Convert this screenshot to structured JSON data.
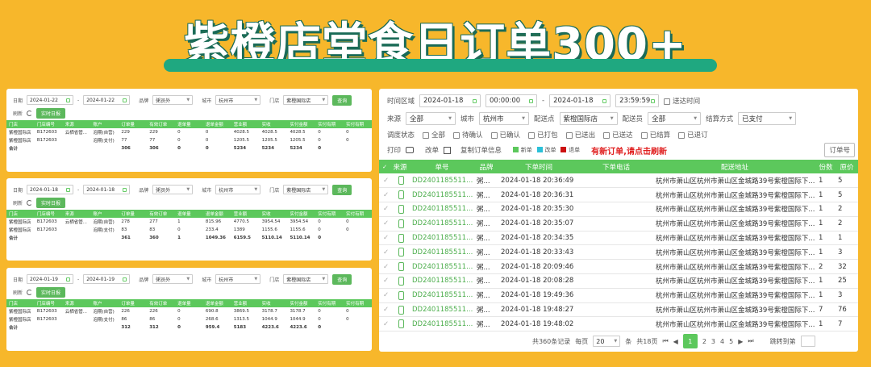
{
  "banner": {
    "title": "紫橙店堂食日订单300+"
  },
  "colors": {
    "accent": "#5cc85c",
    "background": "#f7b72b",
    "alert": "#e02020"
  },
  "left_panels": [
    {
      "filters": {
        "date_label": "日期",
        "date_from": "2024-01-22",
        "date_to": "2024-01-22",
        "brand_label": "品牌",
        "brand": "粥员外",
        "city_label": "城市",
        "city": "杭州市",
        "store_label": "门店",
        "store": "紫橙国际店",
        "query": "查询",
        "refresh_label": "刷新",
        "realtime": "实时日报"
      },
      "columns": [
        "门店",
        "门店编号",
        "来源",
        "账户",
        "订单量",
        "有效订单",
        "退单量",
        "退单金额",
        "营业额",
        "实收",
        "实付金额",
        "实付有期",
        "实付有期"
      ],
      "rows": [
        [
          "紫橙国际店",
          "B172603",
          "云栖省管...",
          "泡期(自营)",
          "229",
          "229",
          "0",
          "0",
          "4028.5",
          "4028.5",
          "4028.5",
          "0",
          "0"
        ],
        [
          "紫橙国际店",
          "B172603",
          "",
          "泡期(支付)",
          "77",
          "77",
          "0",
          "0",
          "1205.5",
          "1205.5",
          "1205.5",
          "0",
          "0"
        ],
        [
          "合计",
          "",
          "",
          "",
          "306",
          "306",
          "0",
          "0",
          "5234",
          "5234",
          "5234",
          "0",
          ""
        ]
      ]
    },
    {
      "filters": {
        "date_label": "日期",
        "date_from": "2024-01-18",
        "date_to": "2024-01-18",
        "brand_label": "品牌",
        "brand": "粥员外",
        "city_label": "城市",
        "city": "杭州市",
        "store_label": "门店",
        "store": "紫橙国际店",
        "query": "查询",
        "refresh_label": "刷新",
        "realtime": "实时日报"
      },
      "columns": [
        "门店",
        "门店编号",
        "来源",
        "账户",
        "订单量",
        "有效订单",
        "退单量",
        "退单金额",
        "营业额",
        "实收",
        "实付金额",
        "实付有期",
        "实付有期"
      ],
      "rows": [
        [
          "紫橙国际店",
          "B172603",
          "云栖省管...",
          "泡期(自营)",
          "278",
          "277",
          "1",
          "815.96",
          "4770.5",
          "3954.54",
          "3954.54",
          "0",
          "0"
        ],
        [
          "紫橙国际店",
          "B172603",
          "",
          "泡期(支付)",
          "83",
          "83",
          "0",
          "233.4",
          "1389",
          "1155.6",
          "1155.6",
          "0",
          "0"
        ],
        [
          "合计",
          "",
          "",
          "",
          "361",
          "360",
          "1",
          "1049.36",
          "6159.5",
          "5110.14",
          "5110.14",
          "0",
          ""
        ]
      ]
    },
    {
      "filters": {
        "date_label": "日期",
        "date_from": "2024-01-19",
        "date_to": "2024-01-19",
        "brand_label": "品牌",
        "brand": "粥员外",
        "city_label": "城市",
        "city": "杭州市",
        "store_label": "门店",
        "store": "紫橙国际店",
        "query": "查询",
        "refresh_label": "刷新",
        "realtime": "实时日报"
      },
      "columns": [
        "门店",
        "门店编号",
        "来源",
        "账户",
        "订单量",
        "有效订单",
        "退单量",
        "退单金额",
        "营业额",
        "实收",
        "实付金额",
        "实付有期",
        "实付有期"
      ],
      "rows": [
        [
          "紫橙国际店",
          "B172603",
          "云栖省管...",
          "泡期(自营)",
          "226",
          "226",
          "0",
          "690.8",
          "3869.5",
          "3178.7",
          "3178.7",
          "0",
          "0"
        ],
        [
          "紫橙国际店",
          "B172603",
          "",
          "泡期(支付)",
          "86",
          "86",
          "0",
          "268.6",
          "1313.5",
          "1044.9",
          "1044.9",
          "0",
          "0"
        ],
        [
          "合计",
          "",
          "",
          "",
          "312",
          "312",
          "0",
          "959.4",
          "5183",
          "4223.6",
          "4223.6",
          "0",
          ""
        ]
      ]
    }
  ],
  "right_panel": {
    "time_label": "时间区域",
    "date_from": "2024-01-18",
    "time_from": "00:00:00",
    "date_to": "2024-01-18",
    "time_to": "23:59:59",
    "delivery_time": "送达时间",
    "source_label": "来源",
    "source": "全部",
    "city_label": "城市",
    "city": "杭州市",
    "dispatch_label": "配送点",
    "dispatch": "紫橙国际店",
    "courier_label": "配送员",
    "courier": "全部",
    "settle_label": "结算方式",
    "settle": "已支付",
    "status_label": "调度状态",
    "statuses": [
      "全部",
      "待确认",
      "已确认",
      "已打包",
      "已送出",
      "已送达",
      "已结算",
      "已退订"
    ],
    "print": "打印",
    "edit": "改单",
    "copy_info": "复制订单信息",
    "legend": [
      {
        "label": "新单",
        "color": "#5cc85c"
      },
      {
        "label": "改单",
        "color": "#2bc0d8"
      },
      {
        "label": "退单",
        "color": "#cc1111"
      }
    ],
    "alert": "有新订单,请点击刷新",
    "order_btn": "订单号",
    "columns": [
      "来源",
      "单号",
      "品牌",
      "下单时间",
      "下单电话",
      "配送地址",
      "份数",
      "原价"
    ],
    "rows": [
      [
        "DD2401185511...",
        "粥...",
        "2024-01-18 20:36:49",
        "杭州市萧山区杭州市萧山区金城路39号紫橙国际下...",
        "1",
        "5"
      ],
      [
        "DD2401185511...",
        "粥...",
        "2024-01-18 20:36:31",
        "杭州市萧山区杭州市萧山区金城路39号紫橙国际下...",
        "1",
        "5"
      ],
      [
        "DD2401185511...",
        "粥...",
        "2024-01-18 20:35:30",
        "杭州市萧山区杭州市萧山区金城路39号紫橙国际下...",
        "1",
        "2"
      ],
      [
        "DD2401185511...",
        "粥...",
        "2024-01-18 20:35:07",
        "杭州市萧山区杭州市萧山区金城路39号紫橙国际下...",
        "1",
        "2"
      ],
      [
        "DD2401185511...",
        "粥...",
        "2024-01-18 20:34:35",
        "杭州市萧山区杭州市萧山区金城路39号紫橙国际下...",
        "1",
        "1"
      ],
      [
        "DD2401185511...",
        "粥...",
        "2024-01-18 20:33:43",
        "杭州市萧山区杭州市萧山区金城路39号紫橙国际下...",
        "1",
        "3"
      ],
      [
        "DD2401185511...",
        "粥...",
        "2024-01-18 20:09:46",
        "杭州市萧山区杭州市萧山区金城路39号紫橙国际下...",
        "2",
        "32"
      ],
      [
        "DD2401185511...",
        "粥...",
        "2024-01-18 20:08:28",
        "杭州市萧山区杭州市萧山区金城路39号紫橙国际下...",
        "1",
        "25"
      ],
      [
        "DD2401185511...",
        "粥...",
        "2024-01-18 19:49:36",
        "杭州市萧山区杭州市萧山区金城路39号紫橙国际下...",
        "1",
        "3"
      ],
      [
        "DD2401185511...",
        "粥...",
        "2024-01-18 19:48:27",
        "杭州市萧山区杭州市萧山区金城路39号紫橙国际下...",
        "7",
        "76"
      ],
      [
        "DD2401185511...",
        "粥...",
        "2024-01-18 19:48:02",
        "杭州市萧山区杭州市萧山区金城路39号紫橙国际下...",
        "1",
        "7"
      ]
    ],
    "pagination": {
      "total": "共360条记录",
      "per_page_label": "每页",
      "per_page": "20",
      "per_page_unit": "条",
      "pages_total": "共18页",
      "pages": [
        "1",
        "2",
        "3",
        "4",
        "5"
      ],
      "jump": "跳转到第"
    }
  }
}
